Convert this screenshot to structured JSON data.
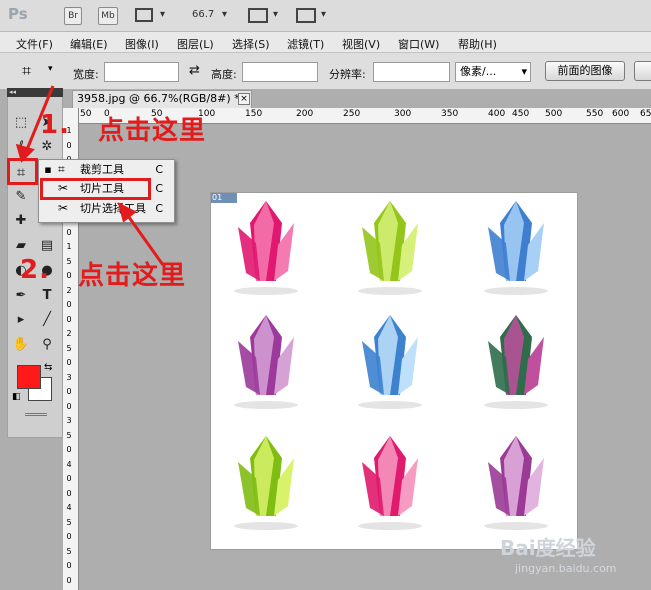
{
  "app": {
    "logo": "Ps",
    "bridge_label": "Br",
    "minibridge_label": "Mb",
    "zoom": "66.7"
  },
  "menu": [
    "文件(F)",
    "编辑(E)",
    "图像(I)",
    "图层(L)",
    "选择(S)",
    "滤镜(T)",
    "视图(V)",
    "窗口(W)",
    "帮助(H)"
  ],
  "options": {
    "width_label": "宽度:",
    "height_label": "高度:",
    "resolution_label": "分辨率:",
    "unit_value": "像素/...",
    "front_image_button": "前面的图像"
  },
  "document": {
    "tab_title": "3958.jpg @ 66.7%(RGB/8#) *",
    "slice_badge": "01"
  },
  "ruler": {
    "top": [
      "50",
      "0",
      "50",
      "100",
      "150",
      "200",
      "250",
      "300",
      "350",
      "400",
      "450",
      "500",
      "550",
      "600",
      "65"
    ],
    "left": [
      "1",
      "0",
      "0",
      "5",
      "0",
      "1",
      "0",
      "0",
      "1",
      "5",
      "0",
      "2",
      "0",
      "0",
      "2",
      "5",
      "0",
      "3",
      "0",
      "0",
      "3",
      "5",
      "0",
      "4",
      "0",
      "0",
      "4",
      "5",
      "0",
      "5",
      "0",
      "0"
    ]
  },
  "flyout": {
    "items": [
      {
        "label": "裁剪工具",
        "key": "C",
        "active": true
      },
      {
        "label": "切片工具",
        "key": "C",
        "active": false
      },
      {
        "label": "切片选择工具",
        "key": "C",
        "active": false
      }
    ]
  },
  "annotations": {
    "step1_num": "1.",
    "step1_text": "点击这里",
    "step2_num": "2.",
    "step2_text": "点击这里"
  },
  "watermark": {
    "brand": "Bai度经验",
    "url": "jingyan.baidu.com"
  },
  "colors": {
    "annotation_red": "#e21c1c",
    "foreground": "#ff1a1a",
    "background": "#ffffff"
  },
  "crystals": [
    {
      "color": "#e0186f",
      "light": "#f47ab2"
    },
    {
      "color": "#93c51b",
      "light": "#d6f07a"
    },
    {
      "color": "#3f7fd0",
      "light": "#a8d0f7"
    },
    {
      "color": "#9b3a9a",
      "light": "#d6a2d6"
    },
    {
      "color": "#3c82cf",
      "light": "#bfe0fa"
    },
    {
      "color": "#2f6d4a",
      "light": "#c04f9e"
    },
    {
      "color": "#7fbd13",
      "light": "#d9f26b"
    },
    {
      "color": "#e01a6d",
      "light": "#f69cc3"
    },
    {
      "color": "#9a3b95",
      "light": "#e3b3e0"
    }
  ]
}
